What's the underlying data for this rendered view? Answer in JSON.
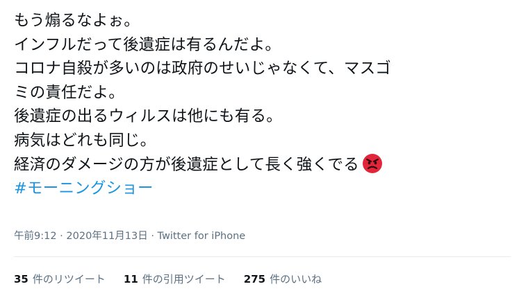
{
  "tweet": {
    "lines": [
      "もう煽るなよぉ。",
      "インフルだって後遺症は有るんだよ。",
      "コロナ自殺が多いのは政府のせいじゃなくて、マスゴ",
      "ミの責任だよ。",
      "後遺症の出るウィルスは他にも有る。",
      "病気はどれも同じ。",
      "経済のダメージの方が後遺症として長く強くでる"
    ],
    "emoji": "angry-face-icon",
    "hashtag": "#モーニングショー",
    "time": "午前9:12",
    "separator1": "·",
    "date": "2020年11月13日",
    "separator2": "·",
    "source": "Twitter for iPhone"
  },
  "stats": {
    "retweets": {
      "count": "35",
      "label": "件のリツイート"
    },
    "quotes": {
      "count": "11",
      "label": "件の引用ツイート"
    },
    "likes": {
      "count": "275",
      "label": "件のいいね"
    }
  },
  "colors": {
    "text": "#0f1419",
    "link": "#1b95e0",
    "muted": "#5b7083",
    "divider": "#e6ecf0",
    "emoji_face": "#e3253c"
  }
}
